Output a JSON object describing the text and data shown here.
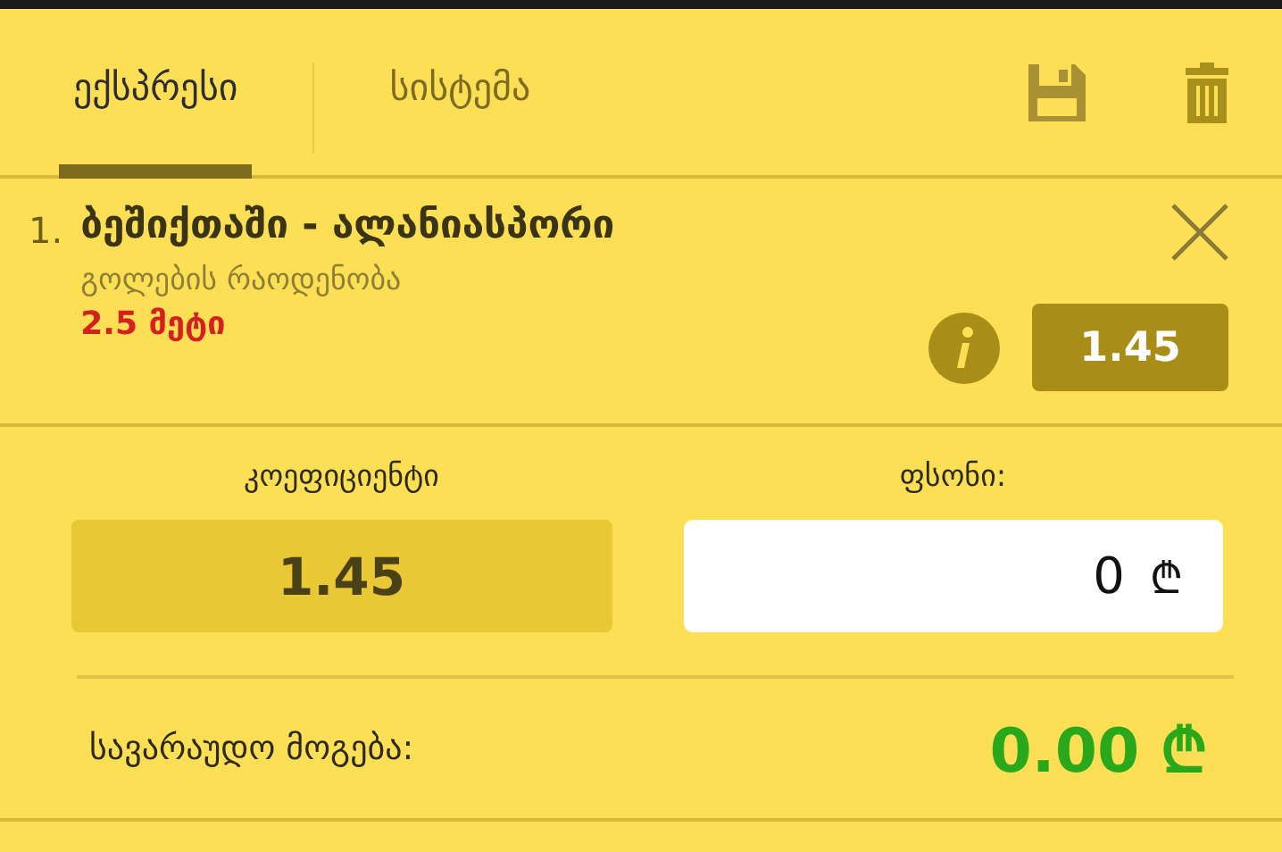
{
  "tabs": [
    {
      "label": "ექსპრესი",
      "selected": true
    },
    {
      "label": "სისტემა",
      "selected": false
    }
  ],
  "bet": {
    "number": "1.",
    "match": "ბეშიქთაში - ალანიასპორი",
    "market": "გოლების რაოდენობა",
    "pick": "2.5 მეტი",
    "odds": "1.45"
  },
  "summary": {
    "odds_label": "კოეფიციენტი",
    "odds": "1.45",
    "stake_label": "ფსონი:",
    "stake": "0",
    "currency": "₾",
    "win_label": "სავარაუდო მოგება:",
    "win": "0.00 ₾"
  }
}
